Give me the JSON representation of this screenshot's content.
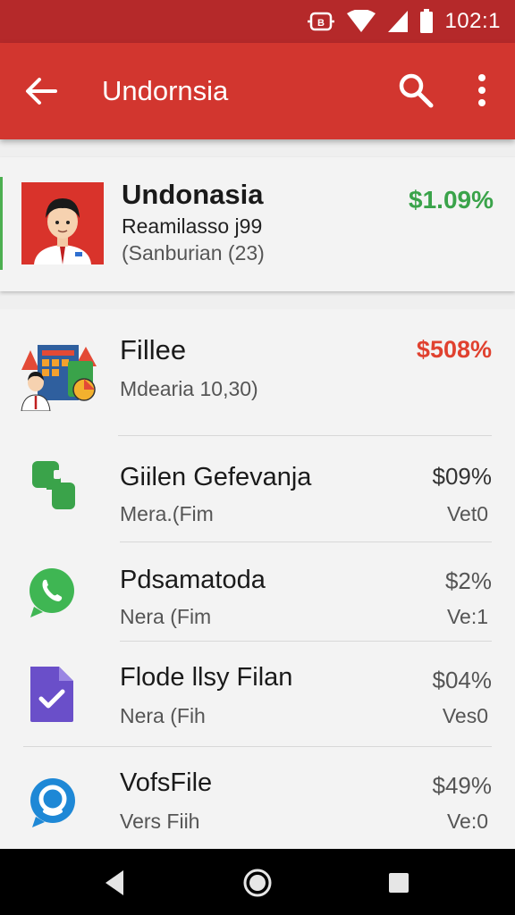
{
  "status_bar": {
    "time": "102:1"
  },
  "app_bar": {
    "title": "Undornsia"
  },
  "featured": {
    "name": "Undonasia",
    "line1": "Reamilasso j99",
    "line2": "(Sanburian (23)",
    "price": "$1.09%"
  },
  "items": [
    {
      "title": "Fillee",
      "subtitle": "Mdearia 10,30)",
      "price": "$508%",
      "value": "",
      "icon": "documents-person-icon"
    },
    {
      "title": "Giilen Gefevanja",
      "subtitle": "Mera.(Fim",
      "price": "$09%",
      "value": "Vet0",
      "icon": "green-puzzle-icon"
    },
    {
      "title": "Pdsamatoda",
      "subtitle": "Nera (Fim",
      "price": "$2%",
      "value": "Ve:1",
      "icon": "whatsapp-icon"
    },
    {
      "title": "Flode llsy Filan",
      "subtitle": "Nera (Fih",
      "price": "$04%",
      "value": "Ves0",
      "icon": "purple-file-check-icon"
    },
    {
      "title": "VofsFile",
      "subtitle": "Vers Fiih",
      "price": "$49%",
      "value": "Ve:0",
      "icon": "blue-chat-icon"
    }
  ],
  "colors": {
    "status_bar": "#b5292a",
    "app_bar": "#d2362f",
    "price_up": "#3aa34a",
    "price_highlight": "#e0412f",
    "text": "#1a1a1a"
  }
}
